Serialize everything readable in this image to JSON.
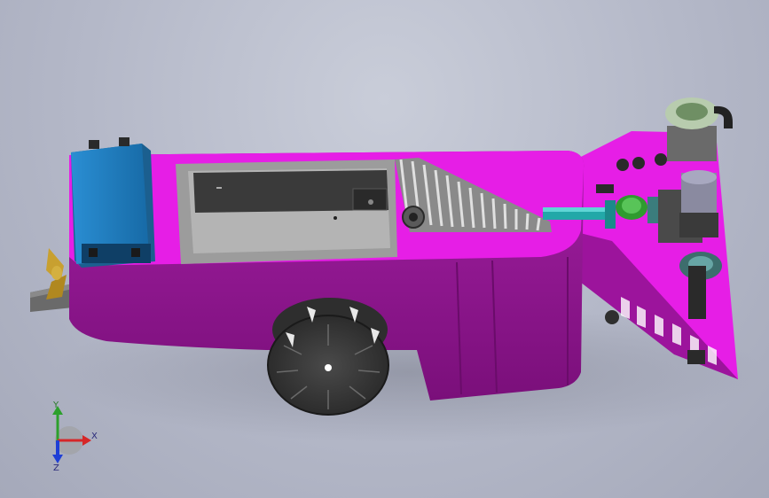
{
  "triad": {
    "x_label": "X",
    "y_label": "Y",
    "z_label": "Z"
  },
  "colors": {
    "hull": "#8c138c",
    "deck": "#e61ee6",
    "battery": "#1f7fc2",
    "tray": "#a7a7a7",
    "pipe": "#22a8a8",
    "wheel": "#3a3a3a",
    "pump": "#7aaa7a"
  }
}
